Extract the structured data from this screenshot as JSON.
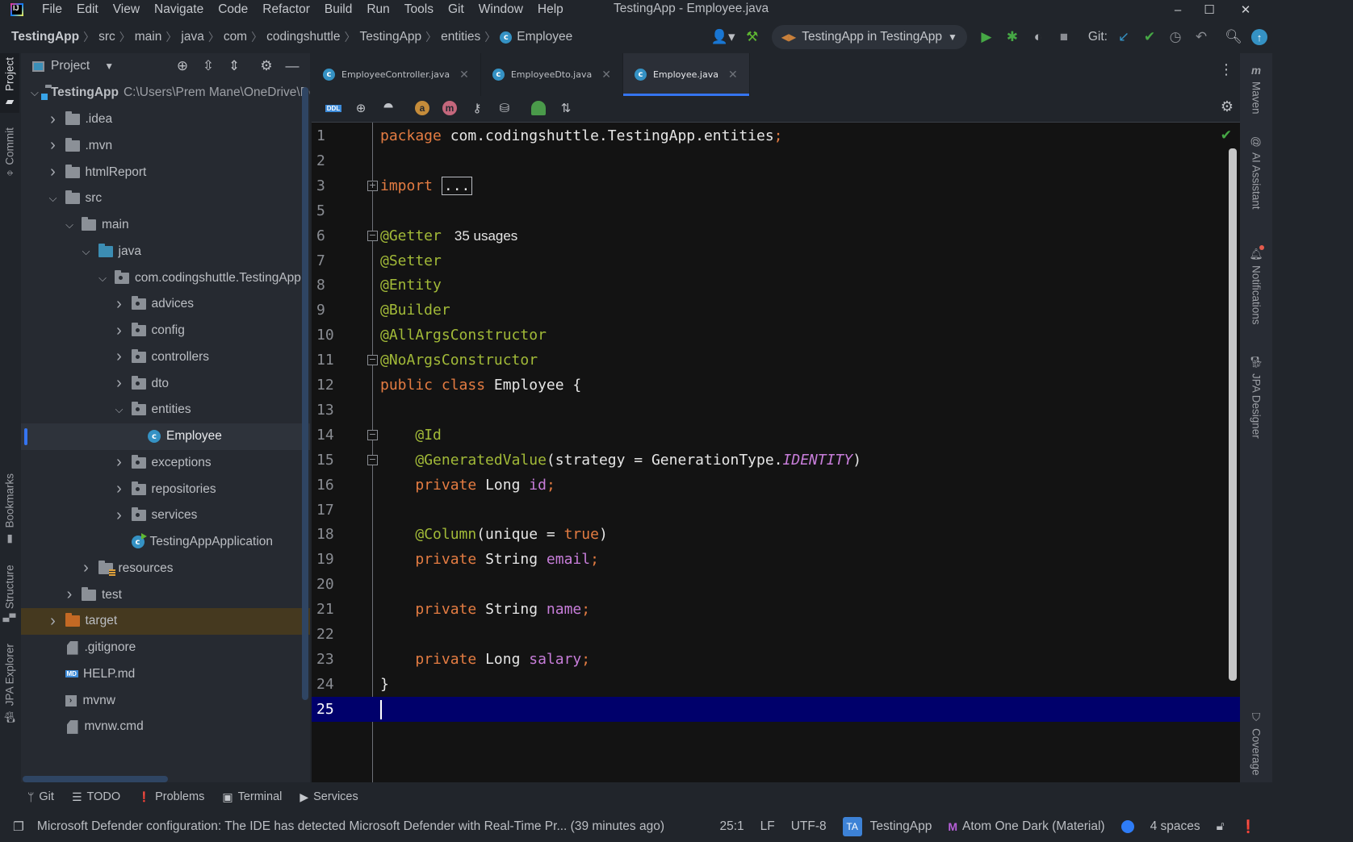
{
  "app": {
    "window_title": "TestingApp - Employee.java",
    "logo_text": "IJ",
    "menu": [
      "File",
      "Edit",
      "View",
      "Navigate",
      "Code",
      "Refactor",
      "Build",
      "Run",
      "Tools",
      "Git",
      "Window",
      "Help"
    ],
    "window_controls": {
      "minimize": "–",
      "maximize": "☐",
      "close": "✕"
    }
  },
  "breadcrumb": [
    "TestingApp",
    "src",
    "main",
    "java",
    "com",
    "codingshuttle",
    "TestingApp",
    "entities",
    "Employee"
  ],
  "toolbar": {
    "run_config": "TestingApp in TestingApp",
    "git_label": "Git:",
    "icons": [
      "profile-icon",
      "build-hammer-icon",
      "run-icon",
      "debug-icon",
      "coverage-run-icon",
      "stop-icon",
      "git-update-icon",
      "git-commit-icon",
      "history-icon",
      "rollback-icon",
      "search-icon",
      "ide-update-icon"
    ]
  },
  "left_stripe": [
    "Project",
    "Commit",
    "Bookmarks",
    "Structure",
    "JPA Explorer"
  ],
  "project_panel": {
    "title": "Project",
    "tree": [
      {
        "label": "TestingApp",
        "hint": "C:\\Users\\Prem Mane\\OneDrive\\De",
        "depth": 0,
        "expand": "open",
        "icon": "module",
        "bold": true
      },
      {
        "label": ".idea",
        "depth": 1,
        "expand": "closed",
        "icon": "folder"
      },
      {
        "label": ".mvn",
        "depth": 1,
        "expand": "closed",
        "icon": "folder"
      },
      {
        "label": "htmlReport",
        "depth": 1,
        "expand": "closed",
        "icon": "folder"
      },
      {
        "label": "src",
        "depth": 1,
        "expand": "open",
        "icon": "folder"
      },
      {
        "label": "main",
        "depth": 2,
        "expand": "open",
        "icon": "folder"
      },
      {
        "label": "java",
        "depth": 3,
        "expand": "open",
        "icon": "src"
      },
      {
        "label": "com.codingshuttle.TestingApp",
        "depth": 4,
        "expand": "open",
        "icon": "pkg"
      },
      {
        "label": "advices",
        "depth": 5,
        "expand": "closed",
        "icon": "pkg"
      },
      {
        "label": "config",
        "depth": 5,
        "expand": "closed",
        "icon": "pkg"
      },
      {
        "label": "controllers",
        "depth": 5,
        "expand": "closed",
        "icon": "pkg"
      },
      {
        "label": "dto",
        "depth": 5,
        "expand": "closed",
        "icon": "pkg"
      },
      {
        "label": "entities",
        "depth": 5,
        "expand": "open",
        "icon": "pkg"
      },
      {
        "label": "Employee",
        "depth": 6,
        "expand": "none",
        "icon": "class",
        "selected": true
      },
      {
        "label": "exceptions",
        "depth": 5,
        "expand": "closed",
        "icon": "pkg"
      },
      {
        "label": "repositories",
        "depth": 5,
        "expand": "closed",
        "icon": "pkg"
      },
      {
        "label": "services",
        "depth": 5,
        "expand": "closed",
        "icon": "pkg"
      },
      {
        "label": "TestingAppApplication",
        "depth": 5,
        "expand": "none",
        "icon": "runclass"
      },
      {
        "label": "resources",
        "depth": 3,
        "expand": "closed",
        "icon": "res"
      },
      {
        "label": "test",
        "depth": 2,
        "expand": "closed",
        "icon": "folder"
      },
      {
        "label": "target",
        "depth": 1,
        "expand": "closed",
        "icon": "orange",
        "excluded": true
      },
      {
        "label": ".gitignore",
        "depth": 1,
        "expand": "none",
        "icon": "file"
      },
      {
        "label": "HELP.md",
        "depth": 1,
        "expand": "none",
        "icon": "md"
      },
      {
        "label": "mvnw",
        "depth": 1,
        "expand": "none",
        "icon": "sh"
      },
      {
        "label": "mvnw.cmd",
        "depth": 1,
        "expand": "none",
        "icon": "file"
      }
    ]
  },
  "editor": {
    "tabs": [
      {
        "label": "EmployeeController.java",
        "active": false
      },
      {
        "label": "EmployeeDto.java",
        "active": false
      },
      {
        "label": "Employee.java",
        "active": true
      }
    ],
    "jpa_toolbar_icons": [
      "ddl-icon",
      "target-icon",
      "hierarchy-icon",
      "attribute-icon",
      "method-icon",
      "key-icon",
      "db-query-icon",
      "entity-table-icon",
      "sort-icon"
    ],
    "current_line": 25,
    "lines": [
      {
        "n": 1,
        "tokens": [
          [
            "kw",
            "package "
          ],
          [
            "plain",
            "com.codingshuttle.TestingApp.entities"
          ],
          [
            "kw",
            ";"
          ]
        ]
      },
      {
        "n": 2,
        "tokens": []
      },
      {
        "n": 3,
        "fold": "+",
        "tokens": [
          [
            "kw",
            "import "
          ],
          [
            "box",
            "..."
          ]
        ]
      },
      {
        "n": 5,
        "tokens": []
      },
      {
        "n": 6,
        "fold": "-",
        "tokens": [
          [
            "ann",
            "@Getter"
          ],
          [
            "hint",
            "35 usages"
          ]
        ]
      },
      {
        "n": 7,
        "tokens": [
          [
            "ann",
            "@Setter"
          ]
        ]
      },
      {
        "n": 8,
        "tokens": [
          [
            "ann",
            "@Entity"
          ]
        ]
      },
      {
        "n": 9,
        "tokens": [
          [
            "ann",
            "@Builder"
          ]
        ]
      },
      {
        "n": 10,
        "tokens": [
          [
            "ann",
            "@AllArgsConstructor"
          ]
        ]
      },
      {
        "n": 11,
        "fold": "-",
        "tokens": [
          [
            "ann",
            "@NoArgsConstructor"
          ]
        ]
      },
      {
        "n": 12,
        "tokens": [
          [
            "kw",
            "public class "
          ],
          [
            "plain",
            "Employee {"
          ]
        ]
      },
      {
        "n": 13,
        "tokens": []
      },
      {
        "n": 14,
        "fold": "-",
        "tokens": [
          [
            "plain",
            "    "
          ],
          [
            "ann",
            "@Id"
          ]
        ]
      },
      {
        "n": 15,
        "fold": "-",
        "tokens": [
          [
            "plain",
            "    "
          ],
          [
            "ann",
            "@GeneratedValue"
          ],
          [
            "plain",
            "(strategy = GenerationType."
          ],
          [
            "const",
            "IDENTITY"
          ],
          [
            "plain",
            ")"
          ]
        ]
      },
      {
        "n": 16,
        "tokens": [
          [
            "plain",
            "    "
          ],
          [
            "kw",
            "private "
          ],
          [
            "plain",
            "Long "
          ],
          [
            "fld",
            "id"
          ],
          [
            "kw",
            ";"
          ]
        ]
      },
      {
        "n": 17,
        "tokens": []
      },
      {
        "n": 18,
        "tokens": [
          [
            "plain",
            "    "
          ],
          [
            "ann",
            "@Column"
          ],
          [
            "plain",
            "(unique = "
          ],
          [
            "kw",
            "true"
          ],
          [
            "plain",
            ")"
          ]
        ]
      },
      {
        "n": 19,
        "tokens": [
          [
            "plain",
            "    "
          ],
          [
            "kw",
            "private "
          ],
          [
            "plain",
            "String "
          ],
          [
            "fld",
            "email"
          ],
          [
            "kw",
            ";"
          ]
        ]
      },
      {
        "n": 20,
        "tokens": []
      },
      {
        "n": 21,
        "tokens": [
          [
            "plain",
            "    "
          ],
          [
            "kw",
            "private "
          ],
          [
            "plain",
            "String "
          ],
          [
            "fld",
            "name"
          ],
          [
            "kw",
            ";"
          ]
        ]
      },
      {
        "n": 22,
        "tokens": []
      },
      {
        "n": 23,
        "tokens": [
          [
            "plain",
            "    "
          ],
          [
            "kw",
            "private "
          ],
          [
            "plain",
            "Long "
          ],
          [
            "fld",
            "salary"
          ],
          [
            "kw",
            ";"
          ]
        ]
      },
      {
        "n": 24,
        "tokens": [
          [
            "plain",
            "}"
          ]
        ]
      },
      {
        "n": 25,
        "tokens": [
          [
            "caret",
            ""
          ]
        ]
      }
    ]
  },
  "right_stripe": [
    "Maven",
    "AI Assistant",
    "Notifications",
    "JPA Designer",
    "Coverage"
  ],
  "bottom_tools": [
    {
      "icon": "git-branch-icon",
      "glyph": "ᛘ",
      "label": "Git"
    },
    {
      "icon": "todo-icon",
      "glyph": "☰",
      "label": "TODO"
    },
    {
      "icon": "problems-icon",
      "glyph": "❗",
      "label": "Problems"
    },
    {
      "icon": "terminal-icon",
      "glyph": "▣",
      "label": "Terminal"
    },
    {
      "icon": "services-icon",
      "glyph": "▶",
      "label": "Services"
    }
  ],
  "status": {
    "message": "Microsoft Defender configuration: The IDE has detected Microsoft Defender with Real-Time Pr... (39 minutes ago)",
    "caret_position": "25:1",
    "line_separator": "LF",
    "encoding": "UTF-8",
    "project_badge": "TA",
    "project": "TestingApp",
    "theme": "Atom One Dark (Material)",
    "indent": "4 spaces",
    "colors": {
      "accent": "#3574f0",
      "current_line": "#00006b",
      "keyword": "#e47c42",
      "annotation": "#a2ba38",
      "field": "#c77dd9"
    }
  }
}
